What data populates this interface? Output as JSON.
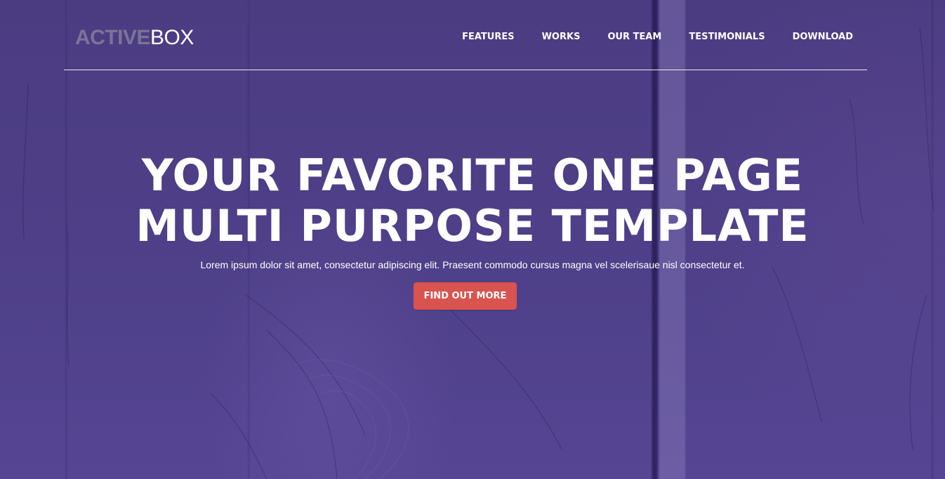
{
  "header": {
    "logo_bold": "ACTIVE",
    "logo_light": "BOX",
    "nav": [
      {
        "label": "FEATURES"
      },
      {
        "label": "WORKS"
      },
      {
        "label": "OUR TEAM"
      },
      {
        "label": "TESTIMONIALS"
      },
      {
        "label": "DOWNLOAD"
      }
    ]
  },
  "hero": {
    "headline_line1": "YOUR FAVORITE ONE PAGE",
    "headline_line2": "MULTI PURPOSE TEMPLATE",
    "subtext": "Lorem ipsum dolor sit amet, consectetur adipiscing elit. Praesent commodo cursus magna vel scelerisaue nisl consectetur et.",
    "cta_label": "FIND OUT MORE"
  },
  "colors": {
    "background": "#4d3e85",
    "cta": "#d9534f",
    "logo_bold": "#7a7497",
    "text": "#ffffff"
  }
}
